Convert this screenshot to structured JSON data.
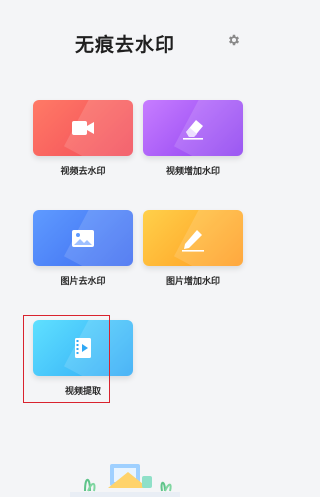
{
  "header": {
    "title": "无痕去水印",
    "settings_icon": "gear-icon"
  },
  "tools": [
    {
      "label": "视频去水印",
      "icon": "video-camera-icon",
      "color": "#f24a58"
    },
    {
      "label": "视频增加水印",
      "icon": "eraser-icon",
      "color": "#8b3df0"
    },
    {
      "label": "图片去水印",
      "icon": "image-icon",
      "color": "#3c6af0"
    },
    {
      "label": "图片增加水印",
      "icon": "pencil-icon",
      "color": "#ff9a1f"
    },
    {
      "label": "视频提取",
      "icon": "film-play-icon",
      "color": "#2fa8f5"
    }
  ],
  "highlight_color": "#d9232e"
}
